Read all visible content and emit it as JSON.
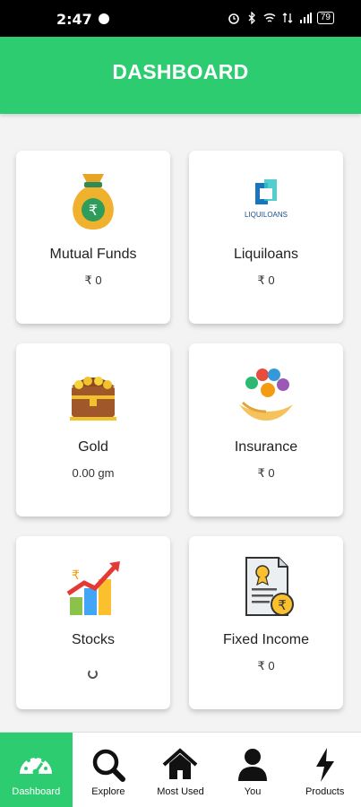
{
  "status": {
    "time": "2:47",
    "battery": "79"
  },
  "header": {
    "title": "DASHBOARD"
  },
  "cards": [
    {
      "title": "Mutual Funds",
      "value": "₹ 0",
      "icon": "money-bag-icon"
    },
    {
      "title": "Liquiloans",
      "value": "₹ 0",
      "icon": "liquiloans-logo",
      "logo_text": "LIQUILOANS"
    },
    {
      "title": "Gold",
      "value": "0.00 gm",
      "icon": "treasure-chest-icon"
    },
    {
      "title": "Insurance",
      "value": "₹ 0",
      "icon": "insurance-hands-icon"
    },
    {
      "title": "Stocks",
      "value": "",
      "icon": "stocks-chart-icon"
    },
    {
      "title": "Fixed Income",
      "value": "₹ 0",
      "icon": "certificate-icon"
    }
  ],
  "nav": [
    {
      "label": "Dashboard",
      "icon": "speedometer-icon",
      "active": true
    },
    {
      "label": "Explore",
      "icon": "search-icon"
    },
    {
      "label": "Most Used",
      "icon": "home-icon"
    },
    {
      "label": "You",
      "icon": "person-icon"
    },
    {
      "label": "Products",
      "icon": "lightning-icon"
    }
  ],
  "colors": {
    "primary": "#2ecc71",
    "rupee_gold": "#f5a623"
  }
}
